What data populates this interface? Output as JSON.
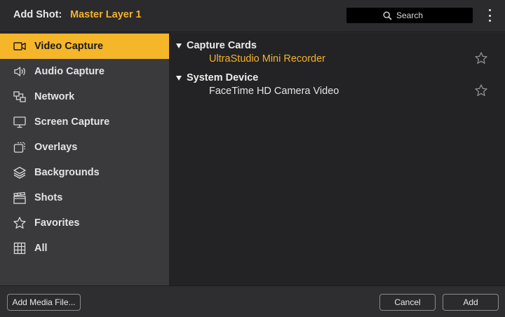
{
  "header": {
    "title_prefix": "Add Shot:",
    "layer_name": "Master Layer 1",
    "search_label": "Search"
  },
  "sidebar": {
    "items": [
      {
        "label": "Video Capture",
        "icon": "video-camera-icon",
        "active": true
      },
      {
        "label": "Audio Capture",
        "icon": "speaker-icon",
        "active": false
      },
      {
        "label": "Network",
        "icon": "network-icon",
        "active": false
      },
      {
        "label": "Screen Capture",
        "icon": "monitor-icon",
        "active": false
      },
      {
        "label": "Overlays",
        "icon": "overlays-icon",
        "active": false
      },
      {
        "label": "Backgrounds",
        "icon": "layers-icon",
        "active": false
      },
      {
        "label": "Shots",
        "icon": "clapperboard-icon",
        "active": false
      },
      {
        "label": "Favorites",
        "icon": "star-icon",
        "active": false
      },
      {
        "label": "All",
        "icon": "grid-icon",
        "active": false
      }
    ]
  },
  "content": {
    "groups": [
      {
        "label": "Capture Cards",
        "entries": [
          {
            "label": "UltraStudio Mini Recorder",
            "selected": true
          }
        ]
      },
      {
        "label": "System Device",
        "entries": [
          {
            "label": "FaceTime HD Camera Video",
            "selected": false
          }
        ]
      }
    ]
  },
  "footer": {
    "add_media_label": "Add Media File...",
    "cancel_label": "Cancel",
    "add_label": "Add"
  },
  "colors": {
    "accent": "#f6b62a",
    "sidebar_bg": "#3a3a3d",
    "content_bg": "#232325"
  }
}
